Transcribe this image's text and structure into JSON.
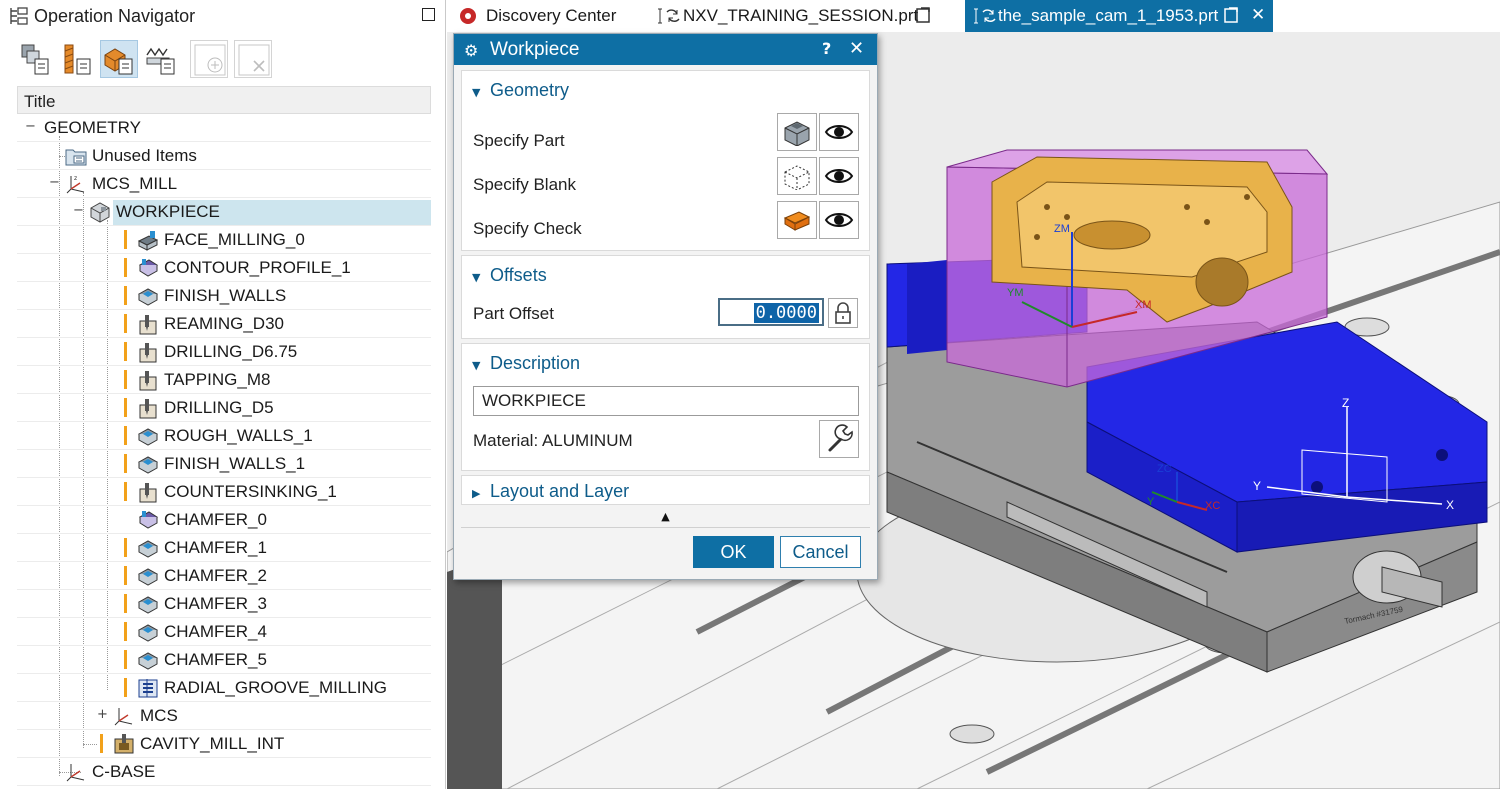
{
  "navigator": {
    "title": "Operation Navigator",
    "column_header": "Title",
    "tree": [
      {
        "label": "GEOMETRY",
        "icon": "none"
      },
      {
        "label": "Unused Items",
        "icon": "folder-icon"
      },
      {
        "label": "MCS_MILL",
        "icon": "mcs-icon"
      },
      {
        "label": "WORKPIECE",
        "icon": "workpiece-icon"
      },
      {
        "label": "FACE_MILLING_0",
        "icon": "face-milling-icon"
      },
      {
        "label": "CONTOUR_PROFILE_1",
        "icon": "contour-profile-icon"
      },
      {
        "label": "FINISH_WALLS",
        "icon": "walls-icon"
      },
      {
        "label": "REAMING_D30",
        "icon": "hole-icon"
      },
      {
        "label": "DRILLING_D6.75",
        "icon": "hole-icon"
      },
      {
        "label": "TAPPING_M8",
        "icon": "hole-icon"
      },
      {
        "label": "DRILLING_D5",
        "icon": "hole-icon"
      },
      {
        "label": "ROUGH_WALLS_1",
        "icon": "walls-icon"
      },
      {
        "label": "FINISH_WALLS_1",
        "icon": "walls-icon"
      },
      {
        "label": "COUNTERSINKING_1",
        "icon": "hole-icon"
      },
      {
        "label": "CHAMFER_0",
        "icon": "contour-profile-icon"
      },
      {
        "label": "CHAMFER_1",
        "icon": "walls-icon"
      },
      {
        "label": "CHAMFER_2",
        "icon": "walls-icon"
      },
      {
        "label": "CHAMFER_3",
        "icon": "walls-icon"
      },
      {
        "label": "CHAMFER_4",
        "icon": "walls-icon"
      },
      {
        "label": "CHAMFER_5",
        "icon": "walls-icon"
      },
      {
        "label": "RADIAL_GROOVE_MILLING",
        "icon": "groove-icon"
      },
      {
        "label": "MCS",
        "icon": "mcs-icon"
      },
      {
        "label": "CAVITY_MILL_INT",
        "icon": "cavity-mill-icon"
      },
      {
        "label": "C-BASE",
        "icon": "mcs-icon"
      }
    ]
  },
  "tabs": [
    {
      "label": "Discovery Center",
      "active": false
    },
    {
      "label": "NXV_TRAINING_SESSION.prt",
      "active": false
    },
    {
      "label": "the_sample_cam_1_1953.prt",
      "active": true
    }
  ],
  "dialog": {
    "title": "Workpiece",
    "help": "?",
    "close": "✕",
    "geometry": {
      "header": "Geometry",
      "specify_part": "Specify Part",
      "specify_blank": "Specify Blank",
      "specify_check": "Specify Check"
    },
    "offsets": {
      "header": "Offsets",
      "part_offset_label": "Part Offset",
      "part_offset_value": "0.0000"
    },
    "description": {
      "header": "Description",
      "value": "WORKPIECE",
      "material": "Material: ALUMINUM"
    },
    "layout": {
      "header": "Layout and Layer"
    },
    "ok": "OK",
    "cancel": "Cancel"
  },
  "viewport": {
    "labels": {
      "zm": "ZM",
      "ym": "YM",
      "xm": "XM",
      "zc": "ZC",
      "yc": "Y",
      "xc": "XC",
      "z": "Z",
      "y": "Y",
      "x": "X",
      "vise_brand": "Tormach #31759"
    }
  },
  "colors": {
    "accent": "#0e6fa4",
    "warning": "#f2a11a",
    "selection": "#cde5ee",
    "part": "#e8b24a",
    "blank": "#c86ad8",
    "check": "#1e22e6"
  }
}
